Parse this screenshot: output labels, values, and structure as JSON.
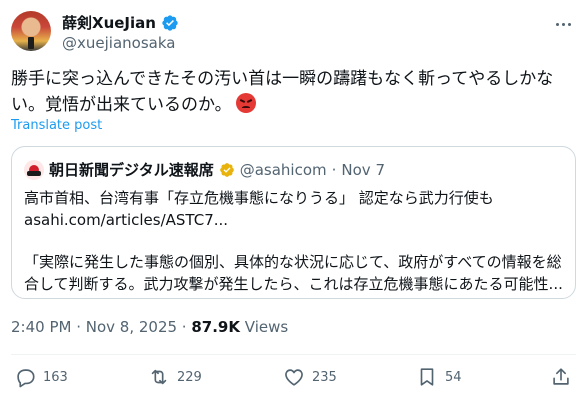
{
  "author": {
    "display_name": "薛剣XueJian",
    "handle": "@xuejianosaka"
  },
  "tweet": {
    "line1": "勝手に突っ込んできたその汚い首は一瞬の躊躇もなく斬ってやるしかな",
    "line2": "い。覚悟が出来ているのか。",
    "emoji": "angry-face-icon"
  },
  "translate_label": "Translate post",
  "quote": {
    "name": "朝日新聞デジタル速報席",
    "handle": "@asahicom",
    "separator": "·",
    "date": "Nov 7",
    "line1": "高市首相、台湾有事「存立危機事態になりうる」 認定なら武力行使も",
    "line2": "asahi.com/articles/ASTC7...",
    "line3": "「実際に発生した事態の個別、具体的な状況に応じて、政府がすべての情報を総",
    "line4": "合して判断する。武力攻撃が発生したら、これは存立危機事態にあたる可能性..."
  },
  "meta": {
    "timestamp": "2:40 PM · Nov 8, 2025 · ",
    "views_count": "87.9K",
    "views_label": " Views"
  },
  "actions": {
    "replies": "163",
    "retweets": "229",
    "likes": "235",
    "bookmarks": "54"
  },
  "colors": {
    "accent": "#1d9bf0",
    "text": "#0f1419",
    "secondary": "#536471",
    "verified_badge": "#1d9bf0",
    "quote_verified_badge": "#e8b30c"
  }
}
